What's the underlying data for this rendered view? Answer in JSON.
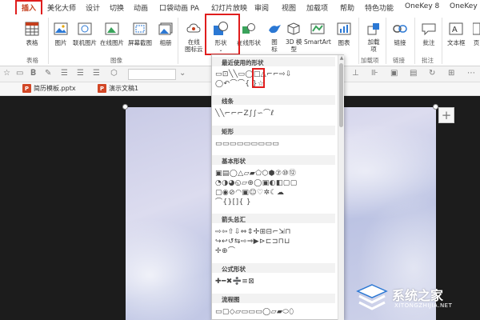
{
  "menu_tabs": [
    {
      "label": "插入"
    },
    {
      "label": "美化大师"
    },
    {
      "label": "设计"
    },
    {
      "label": "切换"
    },
    {
      "label": "动画"
    },
    {
      "label": "口袋动画 PA"
    },
    {
      "label": "幻灯片放映"
    },
    {
      "label": "审阅"
    },
    {
      "label": "视图"
    },
    {
      "label": "加载项"
    },
    {
      "label": "帮助"
    },
    {
      "label": "特色功能"
    },
    {
      "label": "OneKey 8"
    },
    {
      "label": "OneKey 8"
    }
  ],
  "ribbon": {
    "table": "表格",
    "picture": "图片",
    "online_picture": "联机图片",
    "online_picture2": "在线图片",
    "screenshot": "屏幕截图",
    "album": "相册",
    "online_icon_cloud": "在线\n图标云",
    "shapes": "形状",
    "online_shapes": "在线形状",
    "icons": "图\n标",
    "model_3d": "3D 模\n型",
    "smartart": "SmartArt",
    "chart": "图表",
    "addins": "加载\n项",
    "link": "链接",
    "comment": "批注",
    "textbox": "文本框",
    "header_footer": "页",
    "group_table": "表格",
    "group_images": "图像",
    "group_addins": "加载项",
    "group_link": "链接",
    "group_comment": "批注"
  },
  "doc_tabs": [
    {
      "label": "简历模板.pptx"
    },
    {
      "label": "演示文稿1"
    }
  ],
  "shapes_panel": {
    "recent": "最近使用的形状",
    "lines": "线条",
    "rect": "矩形",
    "basic": "基本形状",
    "arrows": "箭头总汇",
    "equation": "公式形状",
    "flowchart": "流程图",
    "recent_row1": "▭⊡╲╲▭◯□△⌐⌐⇨⇩",
    "recent_row2": "◯↶⌒⌒{ }☆",
    "lines_row": "╲╲⌐⌐⌐Z∫∫∽⌒ℓ",
    "rect_row": "▭▭▭▭▭▭▭▭▭",
    "basic_row1": "▣▤◯△▱▰⬠⬡⬢⑦⑩⑫",
    "basic_row2": "◔◑◕◵▱⊕◯▣◐◧▢▢",
    "basic_row3": "▢◉⊘◠▣☺♡✲☾☁",
    "basic_row4": "⌒{}[]{ }",
    "arrows_row1": "⇨⇦⇧⇩⇔⇕✢⊞⊟⌐⇲⊓",
    "arrows_row2": "↪↩↺⇆⇨⇒▶⊳⊏⊐⊓⊔",
    "arrows_row3": "✢⊕⌒",
    "equation_row": "✚━✖➗≡⊠",
    "flowchart_row": "▭▢◇▱▭▭▭◯▱▰⬭⬯"
  },
  "watermark": {
    "name": "系统之家",
    "url": "XITONGZHIJIA.NET"
  },
  "colors": {
    "highlight": "#e01d1d",
    "accent": "#2b78d4",
    "ppt": "#d24726"
  }
}
